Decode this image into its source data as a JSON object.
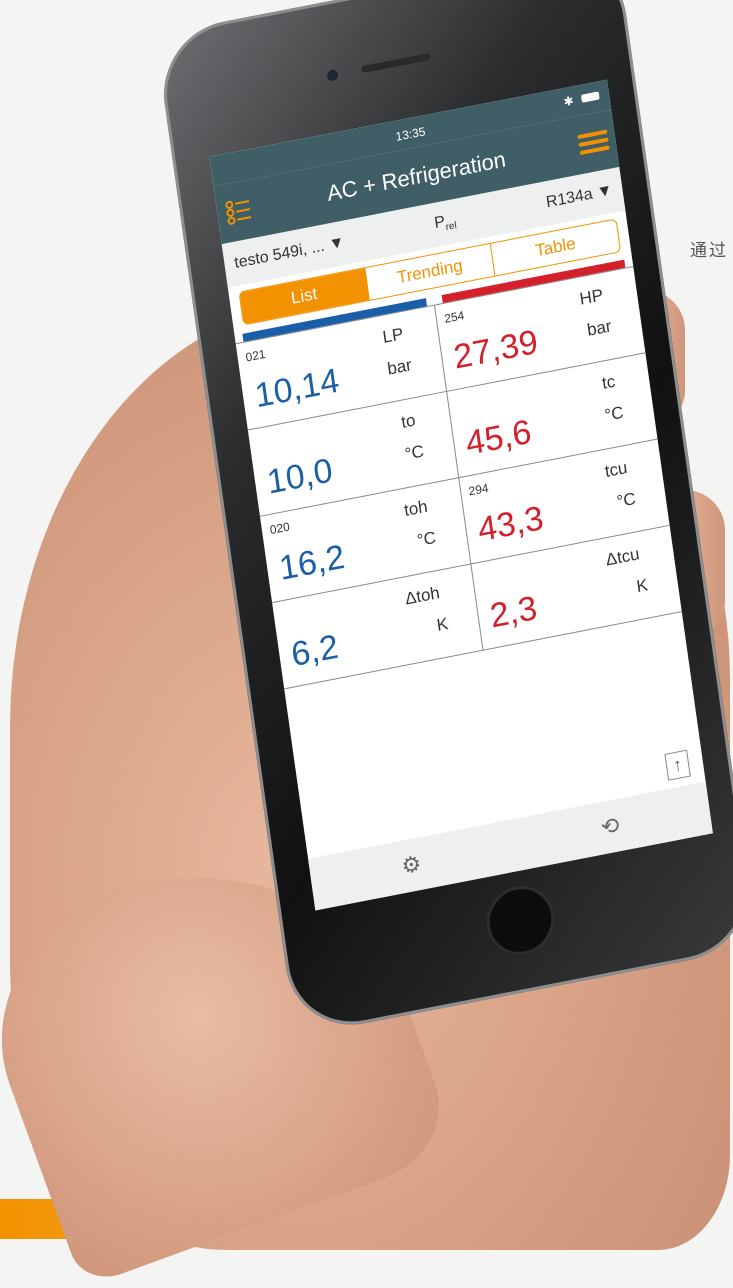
{
  "side_text": "通过",
  "status": {
    "time": "13:35",
    "bluetooth": "bluetooth-icon",
    "battery": "battery-icon"
  },
  "appbar": {
    "title": "AC + Refrigeration"
  },
  "toolbar": {
    "device": "testo 549i, ...",
    "device_caret": "▼",
    "pressure_mode": "P",
    "pressure_sub": "rel",
    "refrigerant": "R134a",
    "refrigerant_caret": "▼"
  },
  "tabs": [
    {
      "label": "List",
      "active": true
    },
    {
      "label": "Trending",
      "active": false
    },
    {
      "label": "Table",
      "active": false
    }
  ],
  "colors": {
    "low_side": "#1a5ea8",
    "high_side": "#d3202b",
    "accent": "#f29200",
    "appbar": "#3f5e66"
  },
  "cells": [
    {
      "id": "021",
      "name": "LP",
      "value": "10,14",
      "unit": "bar",
      "side": "low"
    },
    {
      "id": "254",
      "name": "HP",
      "value": "27,39",
      "unit": "bar",
      "side": "high"
    },
    {
      "id": "",
      "name": "to",
      "value": "10,0",
      "unit": "°C",
      "side": "low"
    },
    {
      "id": "",
      "name": "tc",
      "value": "45,6",
      "unit": "°C",
      "side": "high"
    },
    {
      "id": "020",
      "name": "toh",
      "value": "16,2",
      "unit": "°C",
      "side": "low"
    },
    {
      "id": "294",
      "name": "tcu",
      "value": "43,3",
      "unit": "°C",
      "side": "high"
    },
    {
      "id": "",
      "name": "Δtoh",
      "value": "6,2",
      "unit": "K",
      "side": "low"
    },
    {
      "id": "",
      "name": "Δtcu",
      "value": "2,3",
      "unit": "K",
      "side": "high"
    }
  ],
  "bottombar": {
    "settings": "⚙",
    "reset": "⟲",
    "share": "↑"
  }
}
